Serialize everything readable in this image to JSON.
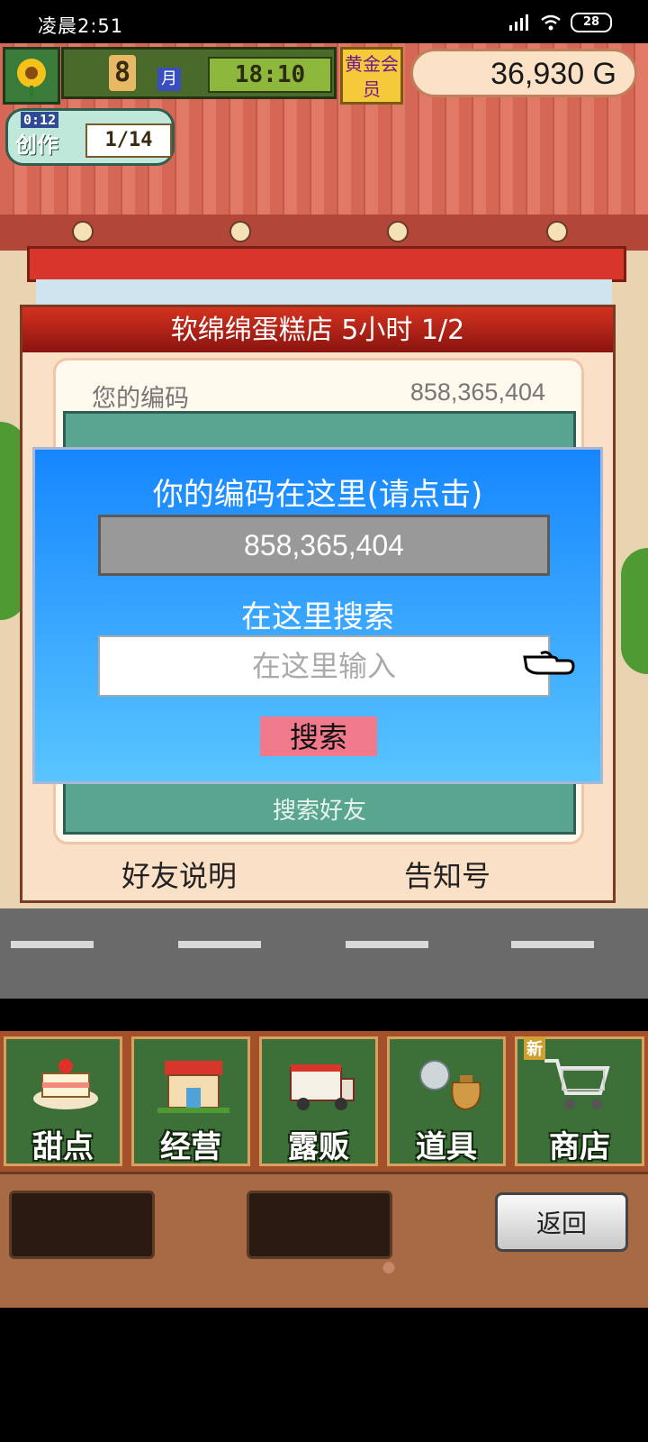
{
  "status_bar": {
    "time": "凌晨2:51",
    "battery": "28"
  },
  "hud": {
    "month_number": "8",
    "month_label": "月",
    "clock": "18:10",
    "member_badge": "黄金会员",
    "money": "36,930 G",
    "task_timer": "0:12",
    "task_label": "创作",
    "task_progress": "1/14"
  },
  "shop": {
    "title": "软绵绵蛋糕店  5小时 1/2",
    "code_label": "您的编码",
    "code_value": "858,365,404",
    "search_friends": "搜索好友",
    "friend_help": "好友说明",
    "notice_number": "告知号"
  },
  "modal": {
    "title": "你的编码在这里(请点击)",
    "code": "858,365,404",
    "search_label": "在这里搜索",
    "input_placeholder": "在这里输入",
    "search_button": "搜索"
  },
  "menu": {
    "items": [
      {
        "label": "甜点",
        "icon": "cake-icon"
      },
      {
        "label": "经营",
        "icon": "shop-building-icon"
      },
      {
        "label": "露贩",
        "icon": "food-truck-icon"
      },
      {
        "label": "道具",
        "icon": "item-bag-icon"
      },
      {
        "label": "商店",
        "icon": "shopping-cart-icon"
      }
    ],
    "new_badge": "新"
  },
  "footer": {
    "back_button": "返回"
  }
}
